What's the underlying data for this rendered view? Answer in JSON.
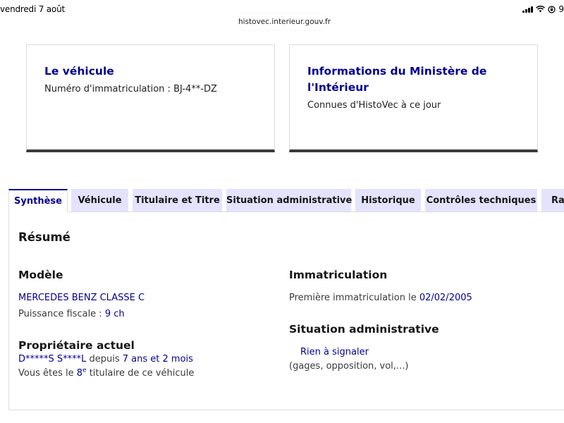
{
  "status_bar": {
    "time": "vendredi 7 août",
    "battery": "9"
  },
  "browser": {
    "url": "histovec.interieur.gouv.fr"
  },
  "cards": {
    "vehicle": {
      "title": "Le véhicule",
      "subtitle": "Numéro d'immatriculation : BJ-4**-DZ"
    },
    "ministere": {
      "title": "Informations du Ministère de l'Intérieur",
      "subtitle": "Connues d'HistoVec à ce jour"
    }
  },
  "tabs": [
    {
      "label": "Synthèse",
      "active": true
    },
    {
      "label": "Véhicule"
    },
    {
      "label": "Titulaire et Titre"
    },
    {
      "label": "Situation administrative"
    },
    {
      "label": "Historique"
    },
    {
      "label": "Contrôles techniques"
    },
    {
      "label": "Rapport"
    }
  ],
  "synthese": {
    "title": "Résumé",
    "modele": {
      "heading": "Modèle",
      "name": "MERCEDES BENZ CLASSE C",
      "puissance_label": "Puissance fiscale : ",
      "puissance_value": "9 ch"
    },
    "proprietaire": {
      "heading": "Propriétaire actuel",
      "name": "D*****S S****L",
      "depuis_label": " depuis ",
      "depuis_value": "7 ans et 2 mois",
      "titulaire_prefix": "Vous êtes le ",
      "titulaire_rank": "8",
      "titulaire_sup": "e",
      "titulaire_suffix": " titulaire de ce véhicule"
    },
    "immatriculation": {
      "heading": "Immatriculation",
      "premiere_label": "Première immatriculation le ",
      "premiere_date": "02/02/2005"
    },
    "situation": {
      "heading": "Situation administrative",
      "status": "Rien à signaler",
      "details": "(gages, opposition, vol,...)"
    }
  },
  "colors": {
    "brand_blue": "#000091",
    "tab_bg": "#e3e3fd",
    "card_border_bottom": "#3a3a3a"
  }
}
